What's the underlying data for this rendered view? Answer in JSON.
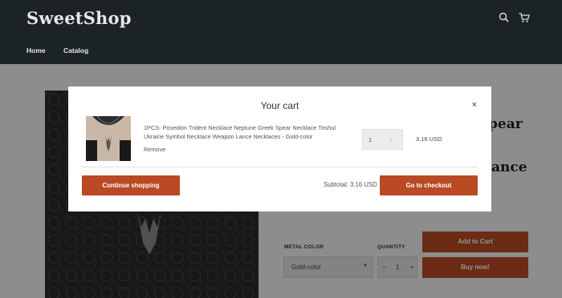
{
  "header": {
    "logo": "SweetShop",
    "nav": [
      {
        "label": "Home"
      },
      {
        "label": "Catalog"
      }
    ],
    "icons": [
      "search-icon",
      "cart-icon"
    ]
  },
  "product": {
    "title_fragments": [
      "pear",
      "ance"
    ],
    "metal_color_label": "METAL COLOR",
    "metal_color_value": "Gold-color",
    "quantity_label": "QUANTITY",
    "quantity_value": "1",
    "qty_minus": "−",
    "qty_plus": "+",
    "add_to_cart": "Add to Cart",
    "buy_now": "Buy now!"
  },
  "cart": {
    "title": "Your cart",
    "close": "×",
    "items": [
      {
        "name": "1PCS- Poseidon Trident Necklace Neptune Greek Spear Necklace Trishul Ukraine Symbol Necklace Weapon Lance Necklaces - Gold-color",
        "remove": "Remove",
        "quantity": "1",
        "qty_sep": ":",
        "price": "3.16 USD"
      }
    ],
    "continue_shopping": "Continue shopping",
    "subtotal": "Subtotal: 3.16 USD",
    "checkout": "Go to checkout"
  },
  "colors": {
    "header_bg": "#1b2326",
    "accent": "#b94a24",
    "overlay": "rgba(0,0,0,0.42)"
  }
}
